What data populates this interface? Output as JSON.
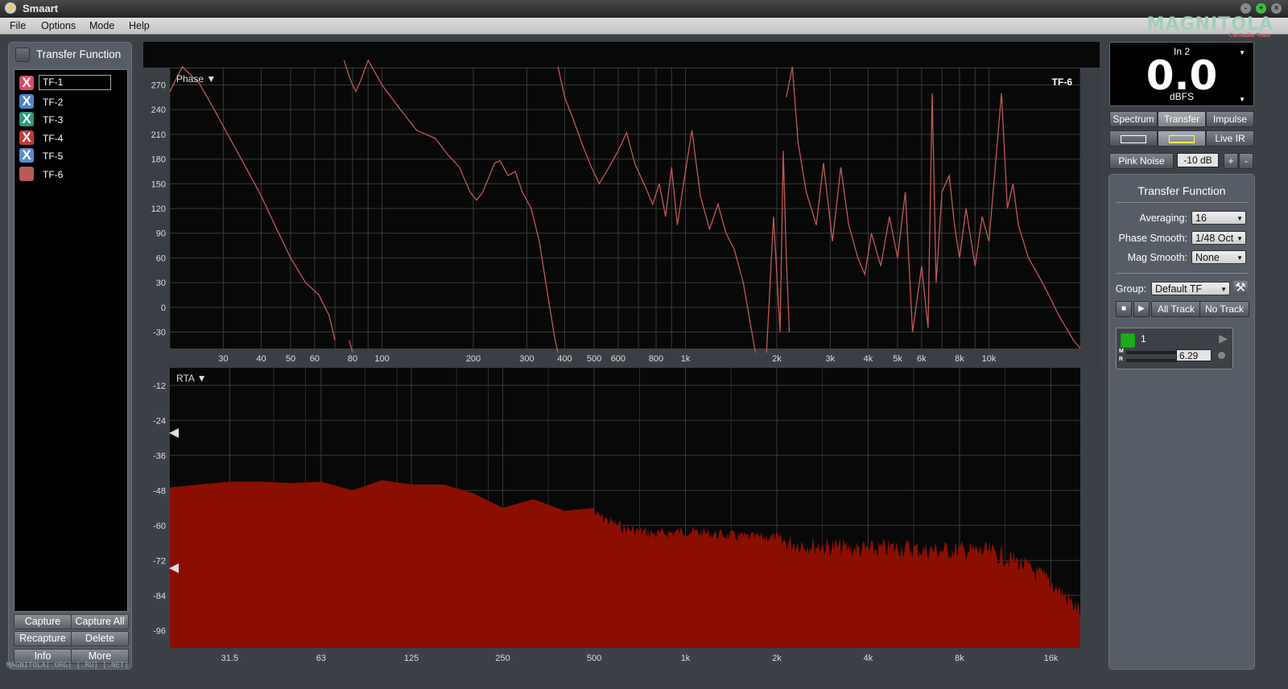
{
  "app": {
    "title": "Smaart",
    "icon": "smaart-logo-icon"
  },
  "watermark_logo": {
    "text": "MAGNITOLA",
    "sub": "CarAudio Team"
  },
  "watermark_text": "MAGNITOLA[.ORG] [.RU] [.NET]",
  "menu": [
    "File",
    "Options",
    "Mode",
    "Help"
  ],
  "window_controls": {
    "minimize": "-",
    "maximize": "+",
    "close": "×"
  },
  "left_panel": {
    "title": "Transfer Function",
    "items": [
      {
        "label": "TF-1",
        "color": "#d94a63",
        "icon": "X",
        "editing": true
      },
      {
        "label": "TF-2",
        "color": "#4a86c8",
        "icon": "X"
      },
      {
        "label": "TF-3",
        "color": "#2e9a82",
        "icon": "X"
      },
      {
        "label": "TF-4",
        "color": "#c23a3a",
        "icon": "X"
      },
      {
        "label": "TF-5",
        "color": "#5a8bd0",
        "icon": "X"
      },
      {
        "label": "TF-6",
        "color": "#b85a55",
        "icon": ""
      }
    ],
    "buttons": [
      "Capture",
      "Capture All",
      "Recapture",
      "Delete",
      "Info",
      "More"
    ]
  },
  "phase_plot": {
    "title": "Phase ▼",
    "trace_name": "TF-6",
    "trace_color": "#c05a55",
    "y_ticks": [
      "270",
      "240",
      "210",
      "180",
      "150",
      "120",
      "90",
      "60",
      "30",
      "0",
      "-30"
    ],
    "x_ticks": [
      "30",
      "40",
      "50",
      "60",
      "80",
      "100",
      "200",
      "300",
      "400",
      "500",
      "600",
      "800",
      "1k",
      "2k",
      "3k",
      "4k",
      "5k",
      "6k",
      "8k",
      "10k"
    ]
  },
  "rta_plot": {
    "title": "RTA ▼",
    "fill_color": "#8b0f00",
    "y_ticks": [
      "-12",
      "-24",
      "-36",
      "-48",
      "-60",
      "-72",
      "-84",
      "-96"
    ],
    "x_ticks": [
      "31.5",
      "63",
      "125",
      "250",
      "500",
      "1k",
      "2k",
      "4k",
      "8k",
      "16k"
    ],
    "markers": [
      "marker-upper",
      "marker-lower"
    ]
  },
  "chart_data": [
    {
      "type": "line",
      "title": "Phase",
      "series": [
        {
          "name": "TF-6",
          "color": "#c05a55"
        }
      ],
      "xscale": "log",
      "xlim": [
        20,
        20000
      ],
      "ylim": [
        -50,
        290
      ]
    },
    {
      "type": "area",
      "title": "RTA",
      "xscale": "log",
      "xlim": [
        20,
        20000
      ],
      "ylim": [
        -102,
        -6
      ],
      "x": [
        20,
        25,
        31.5,
        40,
        50,
        63,
        80,
        100,
        125,
        160,
        200,
        250,
        315,
        400,
        500,
        630,
        800,
        1000,
        1250,
        1600,
        2000,
        2500,
        3150,
        4000,
        5000,
        6300,
        8000,
        10000,
        12500,
        16000,
        20000
      ],
      "values": [
        -47,
        -46,
        -45,
        -45,
        -45.5,
        -45,
        -48,
        -44.5,
        -46,
        -46,
        -49,
        -54,
        -51,
        -55,
        -54,
        -59,
        -61,
        -60,
        -61,
        -62,
        -62,
        -63,
        -64,
        -65,
        -64,
        -65,
        -65,
        -65.5,
        -69,
        -76,
        -86
      ]
    }
  ],
  "meter": {
    "channel": "In 2",
    "value": "0.0",
    "unit": "dBFS"
  },
  "mode_tabs": [
    "Spectrum",
    "Transfer",
    "Impulse"
  ],
  "layout_row": {
    "live_ir": "Live IR"
  },
  "generator": {
    "label": "Pink Noise",
    "level": "-10 dB",
    "plus": "+",
    "minus": "-"
  },
  "tf_settings": {
    "title": "Transfer Function",
    "averaging": {
      "label": "Averaging:",
      "value": "16"
    },
    "phase_smooth": {
      "label": "Phase Smooth:",
      "value": "1/48 Oct"
    },
    "mag_smooth": {
      "label": "Mag Smooth:",
      "value": "None"
    },
    "group": {
      "label": "Group:",
      "value": "Default TF"
    },
    "all_track": "All Track",
    "no_track": "No Track",
    "track": {
      "name": "1",
      "delay": "6.29",
      "m": "M",
      "r": "R",
      "color": "#1eaa1e"
    }
  }
}
